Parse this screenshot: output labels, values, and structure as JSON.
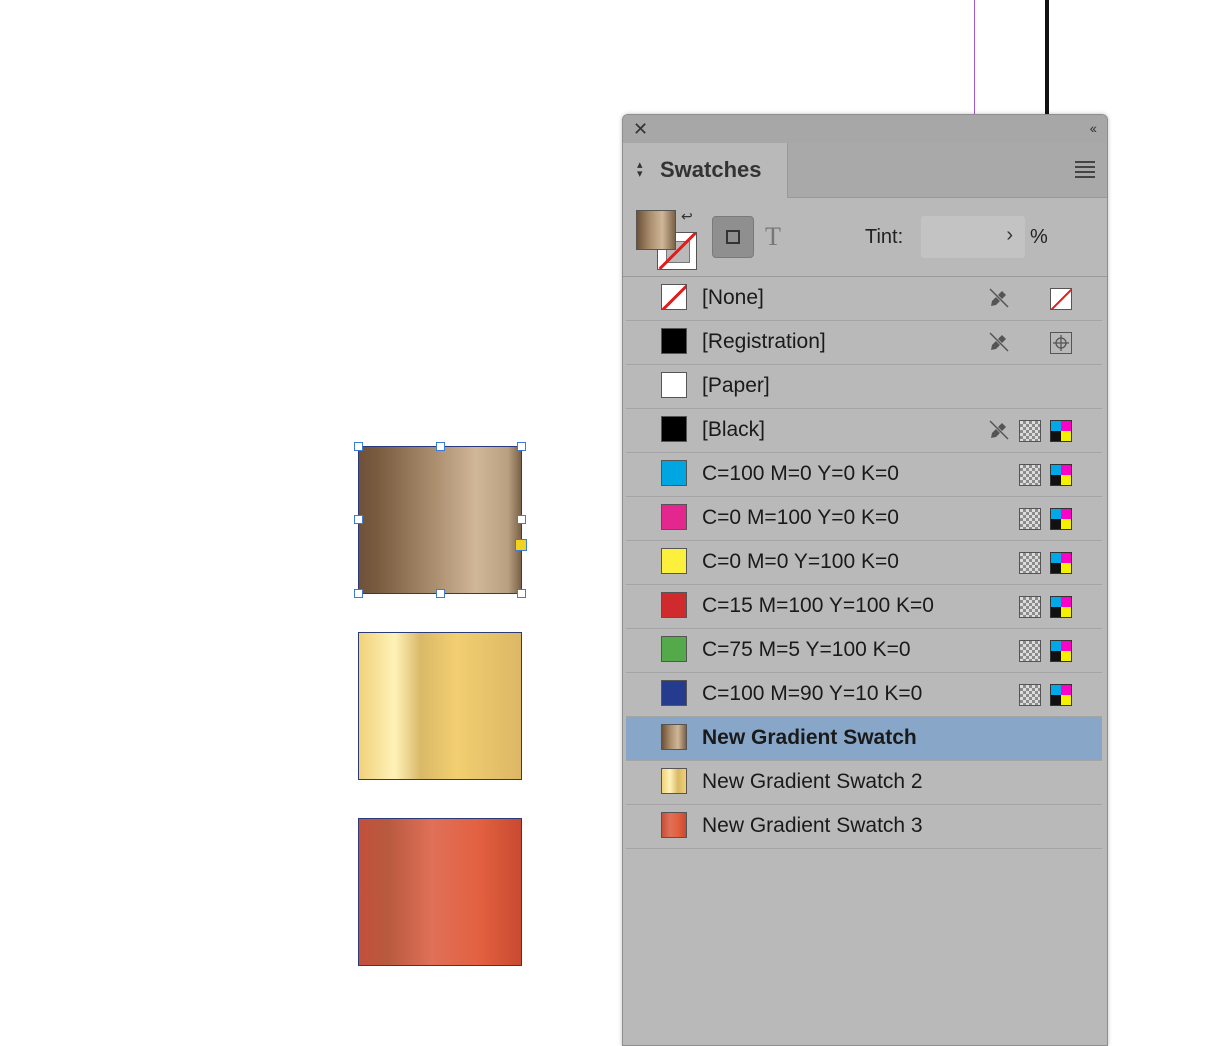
{
  "panel": {
    "tab_label": "Swatches",
    "tint_label": "Tint:",
    "tint_value": "",
    "tint_unit": "%"
  },
  "colors": {
    "selection": "#87a6c8",
    "panel_bg": "#b9b9b9",
    "handle": "#3d7bd9",
    "guide": "#a45ad6"
  },
  "swatches": [
    {
      "name": "[None]",
      "color": "none",
      "icons": [
        "pencil-crossed-icon",
        "none-chip-icon"
      ]
    },
    {
      "name": "[Registration]",
      "color": "#000000",
      "icons": [
        "pencil-crossed-icon",
        "registration-mark-icon"
      ]
    },
    {
      "name": "[Paper]",
      "color": "#ffffff",
      "icons": []
    },
    {
      "name": "[Black]",
      "color": "#000000",
      "icons": [
        "pencil-crossed-icon",
        "process-color-icon",
        "cmyk-mode-icon"
      ]
    },
    {
      "name": "C=100 M=0 Y=0 K=0",
      "color": "#00a6e2",
      "icons": [
        "process-color-icon",
        "cmyk-mode-icon"
      ]
    },
    {
      "name": "C=0 M=100 Y=0 K=0",
      "color": "#e4268f",
      "icons": [
        "process-color-icon",
        "cmyk-mode-icon"
      ]
    },
    {
      "name": "C=0 M=0 Y=100 K=0",
      "color": "#fdf03c",
      "icons": [
        "process-color-icon",
        "cmyk-mode-icon"
      ]
    },
    {
      "name": "C=15 M=100 Y=100 K=0",
      "color": "#cf2a2e",
      "icons": [
        "process-color-icon",
        "cmyk-mode-icon"
      ]
    },
    {
      "name": "C=75 M=5 Y=100 K=0",
      "color": "#54aa4a",
      "icons": [
        "process-color-icon",
        "cmyk-mode-icon"
      ]
    },
    {
      "name": "C=100 M=90 Y=10 K=0",
      "color": "#253b8e",
      "icons": [
        "process-color-icon",
        "cmyk-mode-icon"
      ]
    },
    {
      "name": "New Gradient Swatch",
      "color": "gradient-brown",
      "icons": [],
      "selected": true
    },
    {
      "name": "New Gradient Swatch 2",
      "color": "gradient-gold",
      "icons": []
    },
    {
      "name": "New Gradient Swatch 3",
      "color": "gradient-copper",
      "icons": []
    }
  ]
}
